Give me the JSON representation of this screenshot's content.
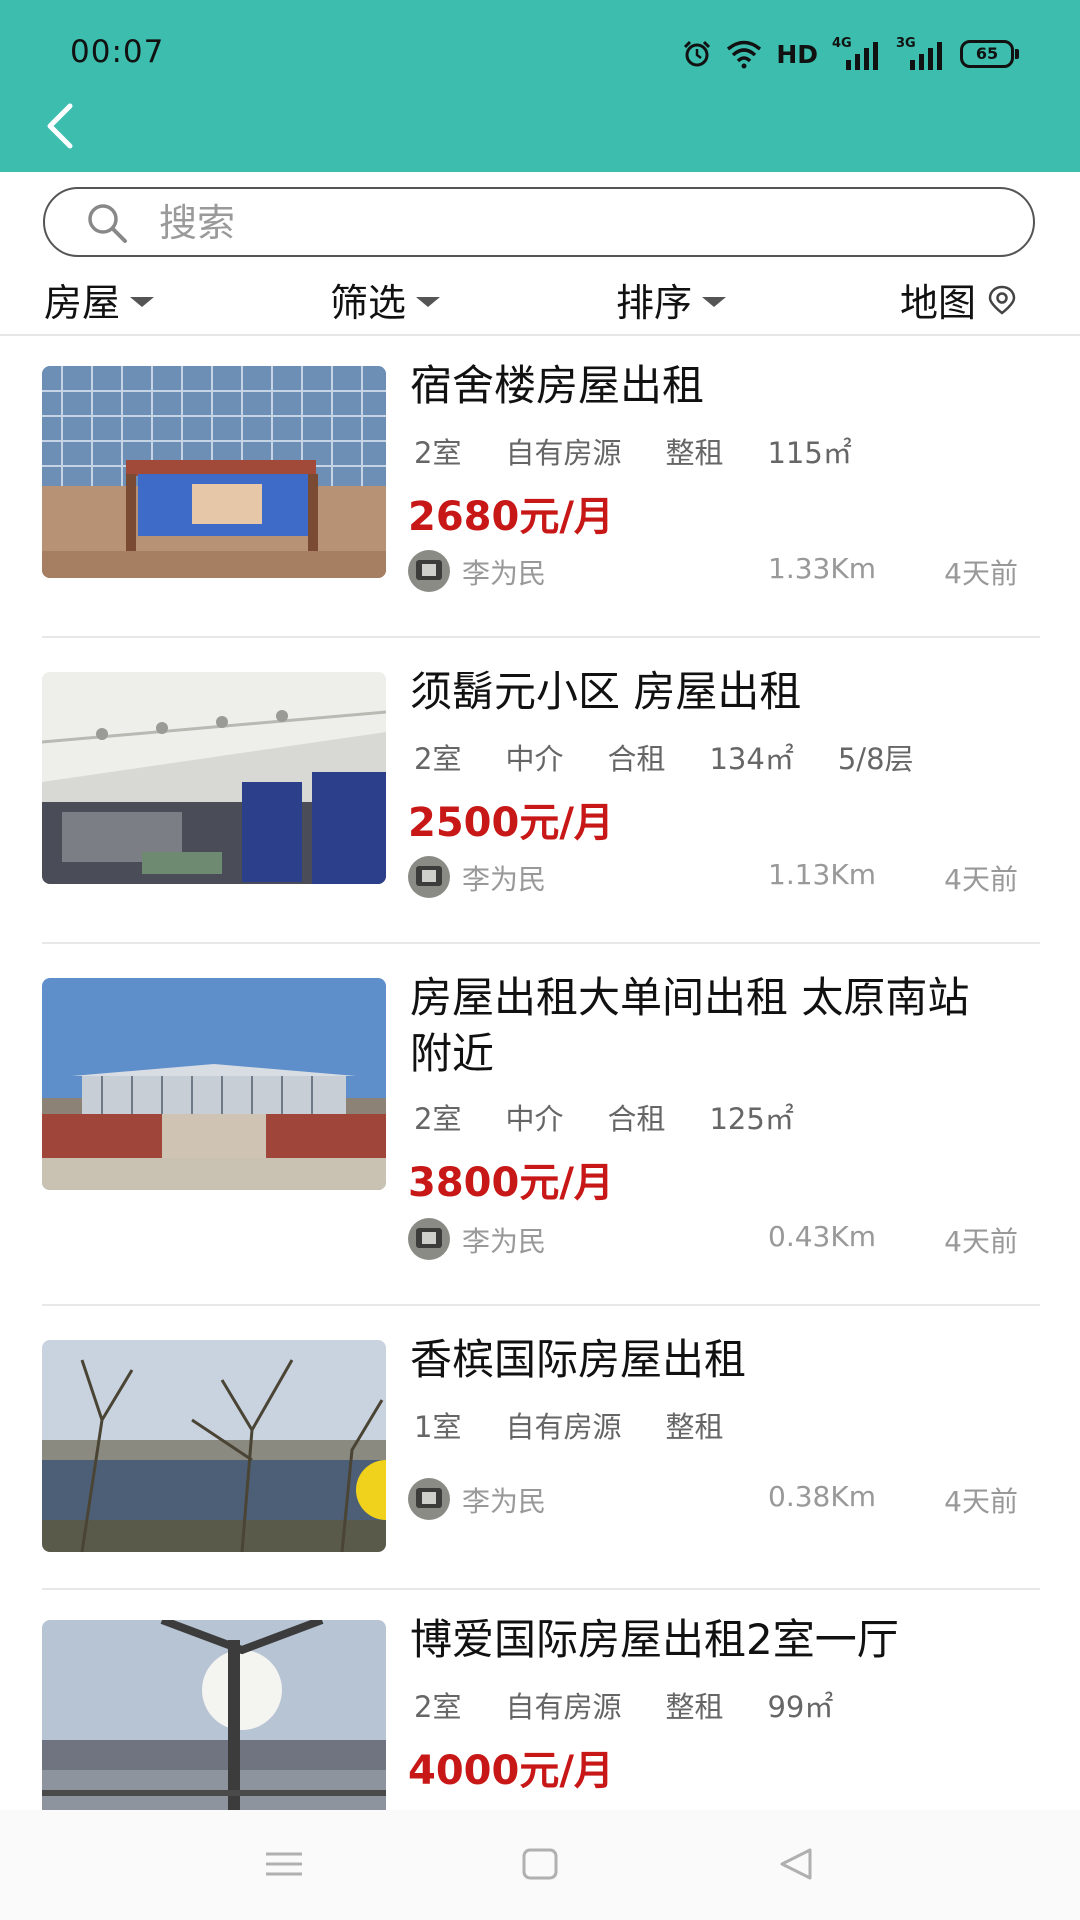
{
  "status_bar": {
    "time": "00:07",
    "hd_label": "HD",
    "net1_label": "4G",
    "net2_label": "3G",
    "battery": "65"
  },
  "search": {
    "placeholder": "搜索",
    "value": ""
  },
  "filters": [
    {
      "label": "房屋"
    },
    {
      "label": "筛选"
    },
    {
      "label": "排序"
    },
    {
      "label": "地图"
    }
  ],
  "listings": [
    {
      "title": "宿舍楼房屋出租",
      "tags": [
        "2室",
        "自有房源",
        "整租",
        "115㎡"
      ],
      "price": "2680元/月",
      "user": "李为民",
      "distance": "1.33Km",
      "time": "4天前",
      "photo": "office-building-billboard"
    },
    {
      "title": "须鬍元小区 房屋出租",
      "tags": [
        "2室",
        "中介",
        "合租",
        "134㎡",
        "5/8层"
      ],
      "price": "2500元/月",
      "user": "李为民",
      "distance": "1.13Km",
      "time": "4天前",
      "photo": "airplane-cabin"
    },
    {
      "title": "房屋出租大单间出租 太原南站附近",
      "tags": [
        "2室",
        "中介",
        "合租",
        "125㎡"
      ],
      "price": "3800元/月",
      "user": "李为民",
      "distance": "0.43Km",
      "time": "4天前",
      "photo": "railway-station"
    },
    {
      "title": "香槟国际房屋出租",
      "tags": [
        "1室",
        "自有房源",
        "整租"
      ],
      "price": "",
      "user": "李为民",
      "distance": "0.38Km",
      "time": "4天前",
      "photo": "riverside-trees"
    },
    {
      "title": "博爱国际房屋出租2室一厅",
      "tags": [
        "2室",
        "自有房源",
        "整租",
        "99㎡"
      ],
      "price": "4000元/月",
      "user": "",
      "distance": "",
      "time": "",
      "photo": "lakeside-pavilion"
    }
  ],
  "colors": {
    "header": "#3dbdad",
    "price": "#c81717",
    "meta_text": "#999999"
  },
  "icons": {
    "back": "chevron-left-icon",
    "search": "search-icon",
    "caret": "caret-down-icon",
    "map": "location-pin-icon"
  }
}
